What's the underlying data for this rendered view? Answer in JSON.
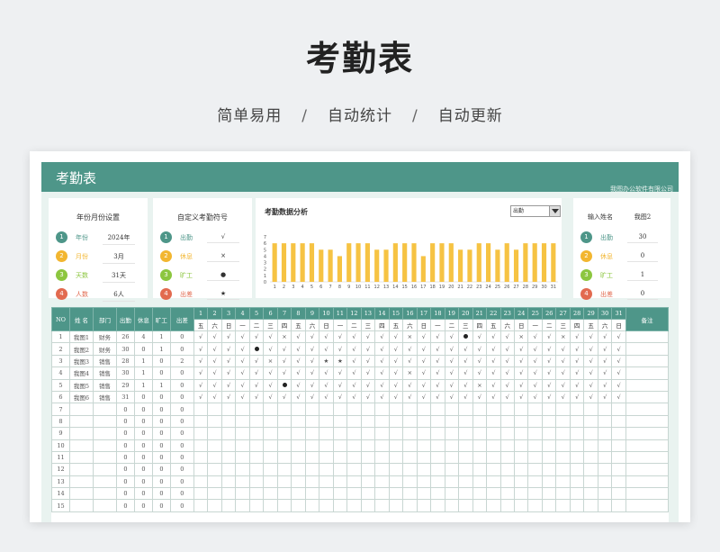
{
  "hero": {
    "title": "考勤表",
    "tags": [
      "简单易用",
      "自动统计",
      "自动更新"
    ],
    "sep": "/"
  },
  "sheet": {
    "title": "考勤表",
    "brand": "我图办公软件有限公司",
    "month_card": {
      "title": "年份月份设置",
      "rows": [
        {
          "n": "1",
          "label": "年份",
          "value": "2024年",
          "color": "#4e9689"
        },
        {
          "n": "2",
          "label": "月份",
          "value": "3月",
          "color": "#f2b630"
        },
        {
          "n": "3",
          "label": "天数",
          "value": "31天",
          "color": "#8cc63f"
        },
        {
          "n": "4",
          "label": "人数",
          "value": "6人",
          "color": "#e26a4f"
        }
      ]
    },
    "symbol_card": {
      "title": "自定义考勤符号",
      "rows": [
        {
          "n": "1",
          "label": "出勤",
          "value": "√",
          "color": "#4e9689"
        },
        {
          "n": "2",
          "label": "休息",
          "value": "×",
          "color": "#f2b630"
        },
        {
          "n": "3",
          "label": "旷工",
          "value": "●",
          "color": "#8cc63f"
        },
        {
          "n": "4",
          "label": "出差",
          "value": "★",
          "color": "#e26a4f"
        }
      ]
    },
    "name_card": {
      "head_label": "输入姓名",
      "head_value": "我图2",
      "rows": [
        {
          "n": "1",
          "label": "出勤",
          "value": "30",
          "color": "#4e9689"
        },
        {
          "n": "2",
          "label": "休息",
          "value": "0",
          "color": "#f2b630"
        },
        {
          "n": "3",
          "label": "旷工",
          "value": "1",
          "color": "#8cc63f"
        },
        {
          "n": "4",
          "label": "出差",
          "value": "0",
          "color": "#e26a4f"
        }
      ]
    },
    "chart_select": "出勤"
  },
  "chart_data": {
    "type": "bar",
    "title": "考勤数据分析",
    "categories": [
      "1",
      "2",
      "3",
      "4",
      "5",
      "6",
      "7",
      "8",
      "9",
      "10",
      "11",
      "12",
      "13",
      "14",
      "15",
      "16",
      "17",
      "18",
      "19",
      "20",
      "21",
      "22",
      "23",
      "24",
      "25",
      "26",
      "27",
      "28",
      "29",
      "30",
      "31"
    ],
    "values": [
      6,
      6,
      6,
      6,
      6,
      5,
      5,
      4,
      6,
      6,
      6,
      5,
      5,
      6,
      6,
      6,
      4,
      6,
      6,
      6,
      5,
      5,
      6,
      6,
      5,
      6,
      5,
      6,
      6,
      6,
      6
    ],
    "ylim": [
      0,
      7
    ],
    "yticks": [
      "0",
      "1",
      "2",
      "3",
      "4",
      "5",
      "6",
      "7"
    ],
    "bar_color": "#f6c343",
    "legend": "none",
    "grid": false
  },
  "table": {
    "headers": {
      "no": "NO",
      "name": "姓 名",
      "dept": "部门",
      "present": "出勤",
      "rest": "休息",
      "absent": "旷工",
      "trip": "出差",
      "note": "备注"
    },
    "days": [
      "1",
      "2",
      "3",
      "4",
      "5",
      "6",
      "7",
      "8",
      "9",
      "10",
      "11",
      "12",
      "13",
      "14",
      "15",
      "16",
      "17",
      "18",
      "19",
      "20",
      "21",
      "22",
      "23",
      "24",
      "25",
      "26",
      "27",
      "28",
      "29",
      "30",
      "31"
    ],
    "weekdays": [
      "五",
      "六",
      "日",
      "一",
      "二",
      "三",
      "四",
      "五",
      "六",
      "日",
      "一",
      "二",
      "三",
      "四",
      "五",
      "六",
      "日",
      "一",
      "二",
      "三",
      "四",
      "五",
      "六",
      "日",
      "一",
      "二",
      "三",
      "四",
      "五",
      "六",
      "日"
    ],
    "rows": [
      {
        "no": "1",
        "name": "我图1",
        "dept": "财务",
        "present": "26",
        "rest": "4",
        "absent": "1",
        "trip": "0",
        "marks": [
          "√",
          "√",
          "√",
          "√",
          "√",
          "√",
          "×",
          "√",
          "√",
          "√",
          "√",
          "√",
          "√",
          "√",
          "√",
          "×",
          "√",
          "√",
          "√",
          "●",
          "√",
          "√",
          "√",
          "×",
          "√",
          "√",
          "×",
          "√",
          "√",
          "√",
          "√"
        ]
      },
      {
        "no": "2",
        "name": "我图2",
        "dept": "财务",
        "present": "30",
        "rest": "0",
        "absent": "1",
        "trip": "0",
        "marks": [
          "√",
          "√",
          "√",
          "√",
          "●",
          "√",
          "√",
          "√",
          "√",
          "√",
          "√",
          "√",
          "√",
          "√",
          "√",
          "√",
          "√",
          "√",
          "√",
          "√",
          "√",
          "√",
          "√",
          "√",
          "√",
          "√",
          "√",
          "√",
          "√",
          "√",
          "√"
        ]
      },
      {
        "no": "3",
        "name": "我图3",
        "dept": "销售",
        "present": "28",
        "rest": "1",
        "absent": "0",
        "trip": "2",
        "marks": [
          "√",
          "√",
          "√",
          "√",
          "√",
          "×",
          "√",
          "√",
          "√",
          "★",
          "★",
          "√",
          "√",
          "√",
          "√",
          "√",
          "√",
          "√",
          "√",
          "√",
          "√",
          "√",
          "√",
          "√",
          "√",
          "√",
          "√",
          "√",
          "√",
          "√",
          "√"
        ]
      },
      {
        "no": "4",
        "name": "我图4",
        "dept": "销售",
        "present": "30",
        "rest": "1",
        "absent": "0",
        "trip": "0",
        "marks": [
          "√",
          "√",
          "√",
          "√",
          "√",
          "√",
          "√",
          "√",
          "√",
          "√",
          "√",
          "√",
          "√",
          "√",
          "√",
          "×",
          "√",
          "√",
          "√",
          "√",
          "√",
          "√",
          "√",
          "√",
          "√",
          "√",
          "√",
          "√",
          "√",
          "√",
          "√"
        ]
      },
      {
        "no": "5",
        "name": "我图5",
        "dept": "销售",
        "present": "29",
        "rest": "1",
        "absent": "1",
        "trip": "0",
        "marks": [
          "√",
          "√",
          "√",
          "√",
          "√",
          "√",
          "●",
          "√",
          "√",
          "√",
          "√",
          "√",
          "√",
          "√",
          "√",
          "√",
          "√",
          "√",
          "√",
          "√",
          "×",
          "√",
          "√",
          "√",
          "√",
          "√",
          "√",
          "√",
          "√",
          "√",
          "√"
        ]
      },
      {
        "no": "6",
        "name": "我图6",
        "dept": "销售",
        "present": "31",
        "rest": "0",
        "absent": "0",
        "trip": "0",
        "marks": [
          "√",
          "√",
          "√",
          "√",
          "√",
          "√",
          "√",
          "√",
          "√",
          "√",
          "√",
          "√",
          "√",
          "√",
          "√",
          "√",
          "√",
          "√",
          "√",
          "√",
          "√",
          "√",
          "√",
          "√",
          "√",
          "√",
          "√",
          "√",
          "√",
          "√",
          "√"
        ]
      },
      {
        "no": "7",
        "name": "",
        "dept": "",
        "present": "0",
        "rest": "0",
        "absent": "0",
        "trip": "0",
        "marks": []
      },
      {
        "no": "8",
        "name": "",
        "dept": "",
        "present": "0",
        "rest": "0",
        "absent": "0",
        "trip": "0",
        "marks": []
      },
      {
        "no": "9",
        "name": "",
        "dept": "",
        "present": "0",
        "rest": "0",
        "absent": "0",
        "trip": "0",
        "marks": []
      },
      {
        "no": "10",
        "name": "",
        "dept": "",
        "present": "0",
        "rest": "0",
        "absent": "0",
        "trip": "0",
        "marks": []
      },
      {
        "no": "11",
        "name": "",
        "dept": "",
        "present": "0",
        "rest": "0",
        "absent": "0",
        "trip": "0",
        "marks": []
      },
      {
        "no": "12",
        "name": "",
        "dept": "",
        "present": "0",
        "rest": "0",
        "absent": "0",
        "trip": "0",
        "marks": []
      },
      {
        "no": "13",
        "name": "",
        "dept": "",
        "present": "0",
        "rest": "0",
        "absent": "0",
        "trip": "0",
        "marks": []
      },
      {
        "no": "14",
        "name": "",
        "dept": "",
        "present": "0",
        "rest": "0",
        "absent": "0",
        "trip": "0",
        "marks": []
      },
      {
        "no": "15",
        "name": "",
        "dept": "",
        "present": "0",
        "rest": "0",
        "absent": "0",
        "trip": "0",
        "marks": []
      }
    ]
  }
}
